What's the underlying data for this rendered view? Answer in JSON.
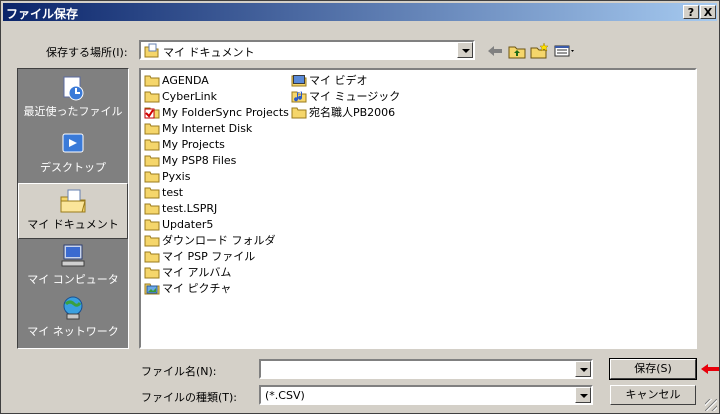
{
  "window": {
    "title": "ファイル保存",
    "help_glyph": "?",
    "close_glyph": "X"
  },
  "save_in": {
    "label": "保存する場所(I):",
    "value": "マイ ドキュメント"
  },
  "places": [
    {
      "label": "最近使ったファイル",
      "icon": "recent-documents-icon"
    },
    {
      "label": "デスクトップ",
      "icon": "desktop-icon"
    },
    {
      "label": "マイ ドキュメント",
      "icon": "my-documents-icon",
      "selected": true
    },
    {
      "label": "マイ コンピュータ",
      "icon": "my-computer-icon"
    },
    {
      "label": "マイ ネットワーク",
      "icon": "network-icon"
    }
  ],
  "files_col1": [
    {
      "name": "AGENDA",
      "icon": "folder"
    },
    {
      "name": "CyberLink",
      "icon": "folder"
    },
    {
      "name": "My FolderSync Projects",
      "icon": "folder-check"
    },
    {
      "name": "My Internet Disk",
      "icon": "folder"
    },
    {
      "name": "My Projects",
      "icon": "folder"
    },
    {
      "name": "My PSP8 Files",
      "icon": "folder"
    },
    {
      "name": "Pyxis",
      "icon": "folder"
    },
    {
      "name": "test",
      "icon": "folder"
    },
    {
      "name": "test.LSPRJ",
      "icon": "folder"
    },
    {
      "name": "Updater5",
      "icon": "folder"
    },
    {
      "name": "ダウンロード フォルダ",
      "icon": "folder"
    },
    {
      "name": "マイ PSP ファイル",
      "icon": "folder"
    },
    {
      "name": "マイ アルバム",
      "icon": "folder"
    },
    {
      "name": "マイ ピクチャ",
      "icon": "folder-pictures"
    }
  ],
  "files_col2": [
    {
      "name": "マイ ビデオ",
      "icon": "folder-video"
    },
    {
      "name": "マイ ミュージック",
      "icon": "folder-music"
    },
    {
      "name": "宛名職人PB2006",
      "icon": "folder"
    }
  ],
  "filename": {
    "label": "ファイル名(N):",
    "value": ""
  },
  "filetype": {
    "label": "ファイルの種類(T):",
    "value": "(*.CSV)"
  },
  "buttons": {
    "save": "保存(S)",
    "cancel": "キャンセル"
  },
  "colors": {
    "title_start": "#0a246a",
    "title_end": "#a6caf0",
    "face": "#d4d0c8",
    "folder": "#f5d66b",
    "arrow": "#e8000b"
  }
}
